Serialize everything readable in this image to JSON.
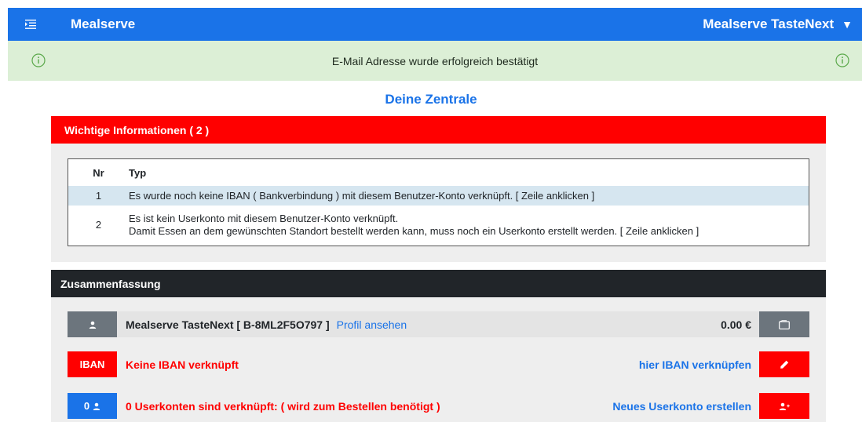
{
  "header": {
    "brand": "Mealserve",
    "account": "Mealserve TasteNext",
    "menu_icon": "list-indent-icon",
    "caret_icon": "caret-down-icon"
  },
  "alert": {
    "message": "E-Mail Adresse wurde erfolgreich bestätigt",
    "icon": "info-circle-icon",
    "color": "#dcefd6"
  },
  "page": {
    "title": "Deine Zentrale"
  },
  "important": {
    "header": "Wichtige Informationen ( 2 )",
    "header_color": "#ff0000",
    "columns": [
      "Nr",
      "Typ"
    ],
    "rows": [
      {
        "nr": "1",
        "lines": [
          "Es wurde noch keine IBAN ( Bankverbindung ) mit diesem Benutzer-Konto verknüpft. [ Zeile anklicken ]"
        ]
      },
      {
        "nr": "2",
        "lines": [
          "Es ist kein Userkonto mit diesem Benutzer-Konto verknüpft.",
          "Damit Essen an dem gewünschten Standort bestellt werden kann, muss noch ein Userkonto erstellt werden. [ Zeile anklicken ]"
        ]
      }
    ]
  },
  "summary": {
    "header": "Zusammenfassung",
    "profile": {
      "name": "Mealserve TasteNext [ B-8ML2F5O797 ]",
      "link": "Profil ansehen",
      "balance": "0.00 €",
      "badge_icon": "user-icon",
      "button_icon": "wallet-icon"
    },
    "iban": {
      "badge": "IBAN",
      "status": "Keine IBAN verknüpft",
      "link": "hier IBAN verknüpfen",
      "button_icon": "pencil-icon"
    },
    "userkonten": {
      "badge_count": "0",
      "badge_icon": "user-icon",
      "status": "0 Userkonten sind verknüpft: ( wird zum Bestellen benötigt )",
      "link": "Neues Userkonto erstellen",
      "button_icon": "user-plus-icon"
    }
  },
  "colors": {
    "primary": "#1a73e8",
    "danger": "#ff0000",
    "dark": "#212529",
    "secondary": "#6c757d"
  }
}
